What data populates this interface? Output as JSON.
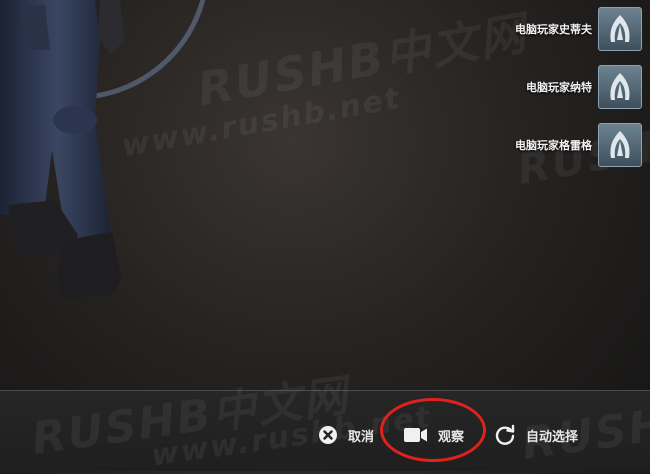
{
  "bots": [
    {
      "name": "电脑玩家史蒂夫",
      "icon": "ct-bot-icon"
    },
    {
      "name": "电脑玩家纳特",
      "icon": "ct-bot-icon"
    },
    {
      "name": "电脑玩家格雷格",
      "icon": "ct-bot-icon"
    }
  ],
  "watermark": {
    "brand": "RUSHB中文网",
    "site": "www.rushb.net"
  },
  "actions": {
    "cancel": {
      "label": "取消",
      "icon": "close-circle-icon"
    },
    "spectate": {
      "label": "观察",
      "icon": "video-camera-icon"
    },
    "auto_select": {
      "label": "自动选择",
      "icon": "refresh-icon"
    }
  },
  "colors": {
    "highlight": "#e0221e",
    "icon_bg": "#4f6370"
  }
}
